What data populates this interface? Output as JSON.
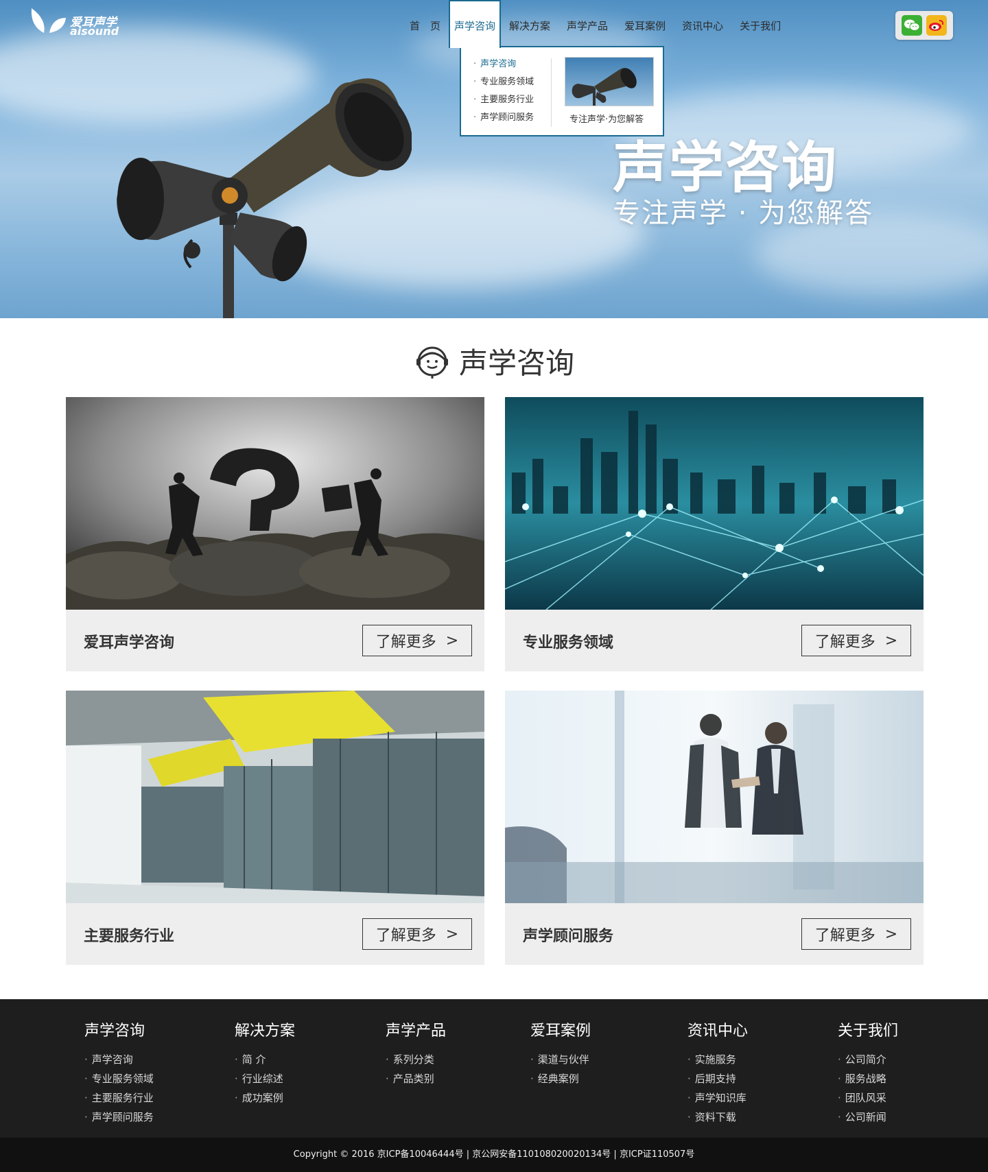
{
  "brand": {
    "name_cn": "爱耳声学",
    "name_en": "aisound"
  },
  "nav": {
    "items": [
      {
        "label": "首　页"
      },
      {
        "label": "声学咨询",
        "active": true
      },
      {
        "label": "解决方案"
      },
      {
        "label": "声学产品"
      },
      {
        "label": "爱耳案例"
      },
      {
        "label": "资讯中心"
      },
      {
        "label": "关于我们"
      }
    ]
  },
  "dropdown": {
    "items": [
      "声学咨询",
      "专业服务领域",
      "主要服务行业",
      "声学顾问服务"
    ],
    "caption": "专注声学·为您解答"
  },
  "social": {
    "icons": [
      "wechat-icon",
      "weibo-icon"
    ],
    "colors": {
      "wechat": "#3cb034",
      "weibo": "#f2b61c"
    }
  },
  "hero": {
    "title": "声学咨询",
    "subtitle": "专注声学 · 为您解答"
  },
  "section": {
    "title": "声学咨询"
  },
  "cards": [
    {
      "label": "爱耳声学咨询",
      "button": "了解更多"
    },
    {
      "label": "专业服务领域",
      "button": "了解更多"
    },
    {
      "label": "主要服务行业",
      "button": "了解更多"
    },
    {
      "label": "声学顾问服务",
      "button": "了解更多"
    }
  ],
  "footer": {
    "columns": [
      {
        "title": "声学咨询",
        "links": [
          "声学咨询",
          "专业服务领域",
          "主要服务行业",
          "声学顾问服务"
        ]
      },
      {
        "title": "解决方案",
        "links": [
          "简 介",
          "行业综述",
          "成功案例"
        ]
      },
      {
        "title": "声学产品",
        "links": [
          "系列分类",
          "产品类别"
        ]
      },
      {
        "title": "爱耳案例",
        "links": [
          "渠道与伙伴",
          "经典案例"
        ]
      },
      {
        "title": "资讯中心",
        "links": [
          "实施服务",
          "后期支持",
          "声学知识库",
          "资料下载"
        ]
      },
      {
        "title": "关于我们",
        "links": [
          "公司简介",
          "服务战略",
          "团队风采",
          "公司新闻"
        ]
      }
    ],
    "copyright": "Copyright © 2016  京ICP备10046444号 | 京公网安备110108020020134号 | 京ICP证110507号"
  },
  "colors": {
    "accent": "#1a6a8f",
    "footer_bg": "#1e1e1e",
    "card_bg": "#eeeeee"
  }
}
